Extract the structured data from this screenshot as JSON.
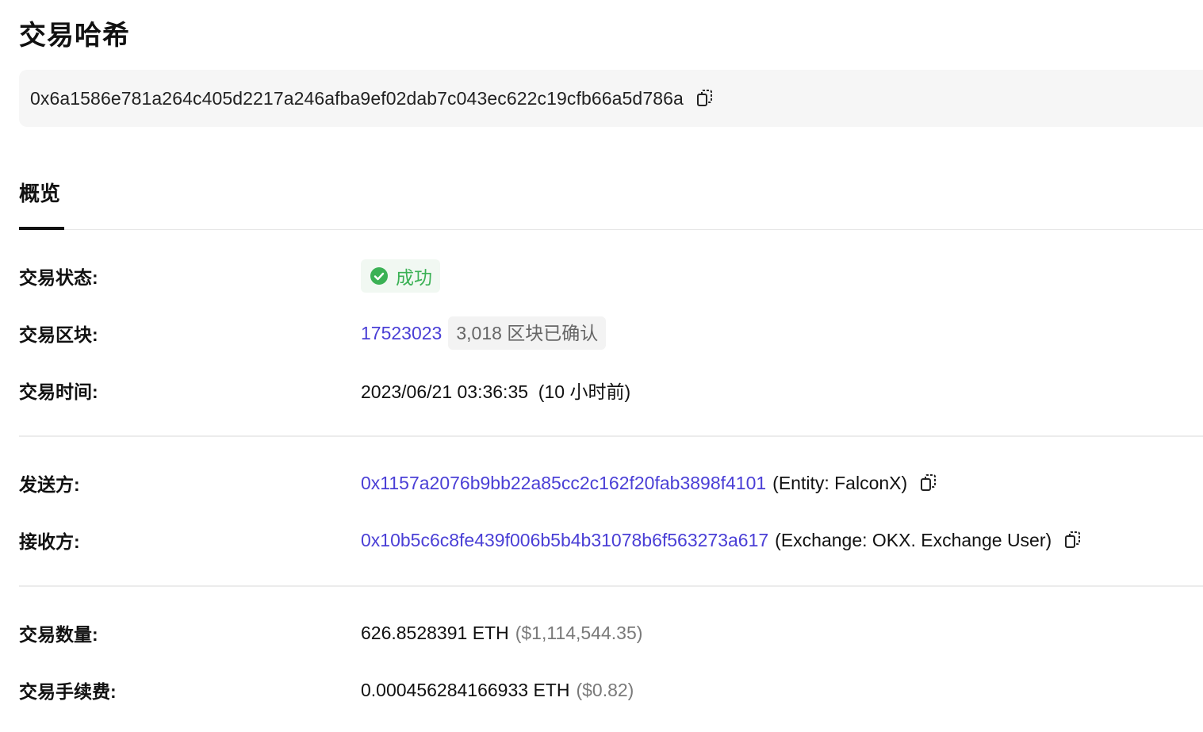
{
  "title": "交易哈希",
  "hash": {
    "value": "0x6a1586e781a264c405d2217a246afba9ef02dab7c043ec622c19cfb66a5d786a",
    "copy_icon": "copy-icon"
  },
  "tabs": [
    {
      "label": "概览",
      "active": true
    }
  ],
  "overview": {
    "status": {
      "label": "交易状态:",
      "value": "成功",
      "icon": "check-circle-icon",
      "color": "#3bb155"
    },
    "block": {
      "label": "交易区块:",
      "number": "17523023",
      "confirmations": "3,018 区块已确认"
    },
    "time": {
      "label": "交易时间:",
      "value": "2023/06/21 03:36:35  (10 小时前)"
    },
    "from": {
      "label": "发送方:",
      "address": "0x1157a2076b9bb22a85cc2c162f20fab3898f4101",
      "tag": "(Entity: FalconX)"
    },
    "to": {
      "label": "接收方:",
      "address": "0x10b5c6c8fe439f006b5b4b31078b6f563273a617",
      "tag": "(Exchange: OKX. Exchange User)"
    },
    "amount": {
      "label": "交易数量:",
      "value": "626.8528391 ETH",
      "usd": "($1,114,544.35)"
    },
    "fee": {
      "label": "交易手续费:",
      "value": "0.000456284166933 ETH",
      "usd": "($0.82)"
    }
  },
  "colors": {
    "link": "#4a3fd6",
    "success": "#3bb155",
    "hash_background": "#f6f6f6"
  }
}
